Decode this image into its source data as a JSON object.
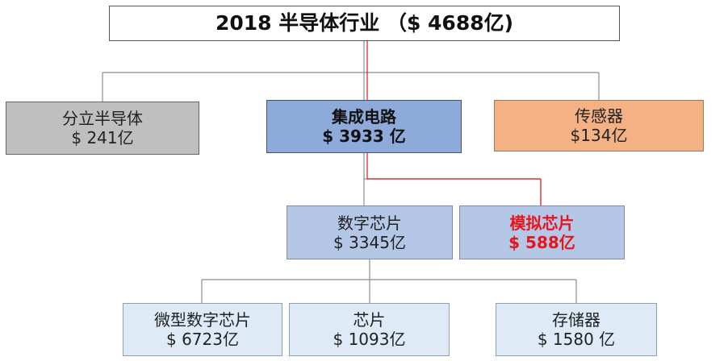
{
  "root": {
    "label": "2018 半导体行业 （$ 4688亿)"
  },
  "nodes": {
    "discrete": {
      "name": "分立半导体",
      "value": "$ 241亿"
    },
    "ic": {
      "name": "集成电路",
      "value": "$ 3933 亿"
    },
    "sensor": {
      "name": "传感器",
      "value": "$134亿"
    },
    "digital": {
      "name": "数字芯片",
      "value": "$ 3345亿"
    },
    "analog": {
      "name": "模拟芯片",
      "value": "$ 588亿"
    },
    "micro": {
      "name": "微型数字芯片",
      "value": "$ 6723亿"
    },
    "chip": {
      "name": "芯片",
      "value": "$ 1093亿"
    },
    "memory": {
      "name": "存储器",
      "value": "$ 1580 亿"
    }
  },
  "colors": {
    "discrete_fill": "#bfbfbf",
    "ic_fill": "#8eaadb",
    "sensor_fill": "#f4b183",
    "digital_fill": "#b4c7e7",
    "analog_fill": "#b4c7e7",
    "leaf_fill": "#deebf7",
    "connector": "#8c8c8c",
    "highlight": "#e8141c"
  }
}
